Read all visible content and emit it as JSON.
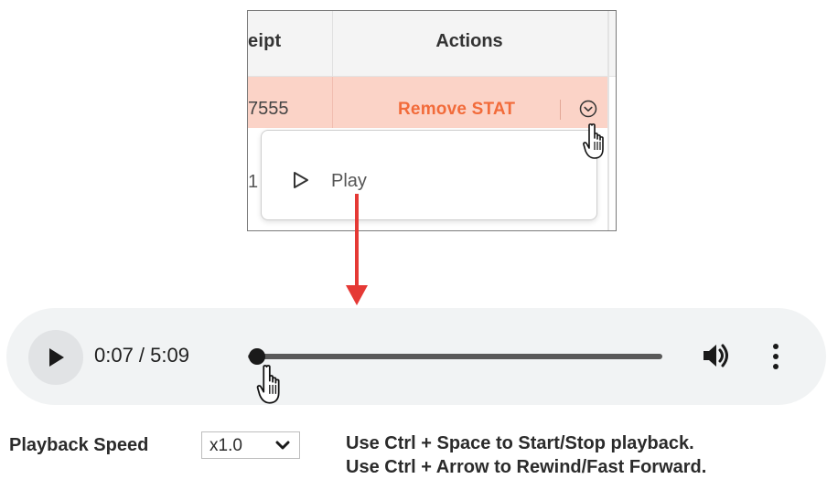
{
  "table": {
    "header_receipt_fragment": "eipt",
    "header_actions": "Actions",
    "row1_receipt_fragment": "7555",
    "row1_action_label": "Remove STAT",
    "row2_receipt_fragment": "1",
    "highlight_color": "#fbd3c7",
    "action_color": "#f26b3a",
    "menu": {
      "items": [
        {
          "icon": "play-outline-icon",
          "label": "Play"
        }
      ]
    }
  },
  "arrow_color": "#e53935",
  "player": {
    "time": "0:07 / 5:09",
    "progress_fraction": 0.0227,
    "icons": {
      "play": "play-icon",
      "volume": "volume-icon",
      "more": "more-vertical-icon"
    }
  },
  "controls": {
    "speed_label": "Playback Speed",
    "speed_value": "x1.0",
    "help_line_1": "Use Ctrl + Space to Start/Stop playback.",
    "help_line_2": "Use Ctrl + Arrow to Rewind/Fast Forward."
  }
}
